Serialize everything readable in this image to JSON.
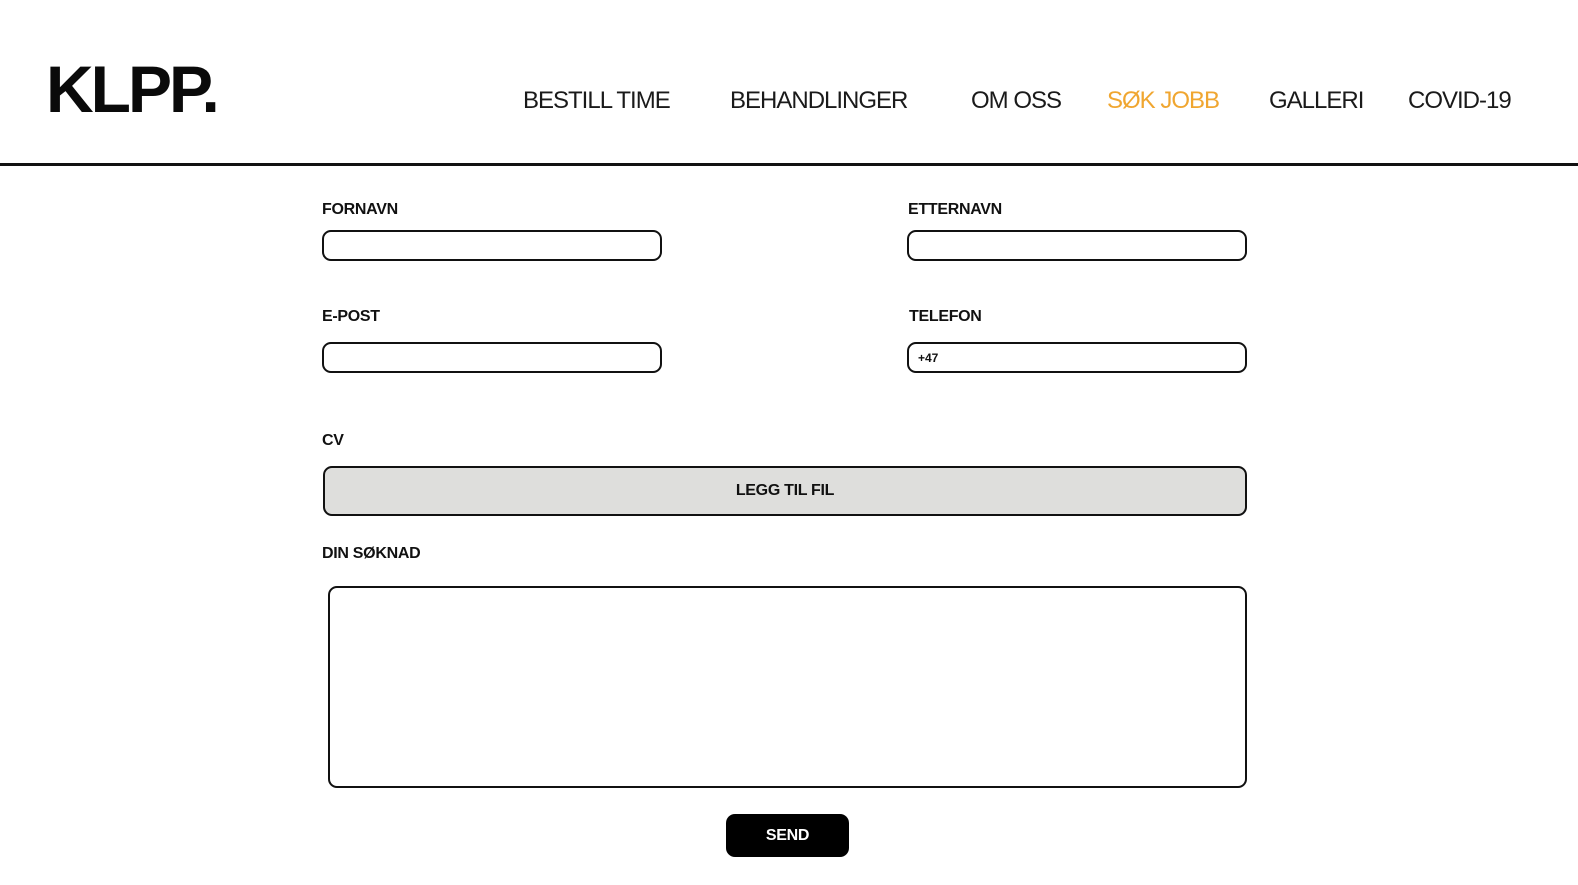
{
  "header": {
    "logo": "KLPP.",
    "nav": [
      {
        "label": "BESTILL TIME",
        "active": false
      },
      {
        "label": "BEHANDLINGER",
        "active": false
      },
      {
        "label": "OM OSS",
        "active": false
      },
      {
        "label": "SØK JOBB",
        "active": true
      },
      {
        "label": "GALLERI",
        "active": false
      },
      {
        "label": "COVID-19",
        "active": false
      }
    ],
    "active_color": "#f0a630"
  },
  "form": {
    "first_name": {
      "label": "FORNAVN",
      "value": ""
    },
    "last_name": {
      "label": "ETTERNAVN",
      "value": ""
    },
    "email": {
      "label": "E-POST",
      "value": ""
    },
    "phone": {
      "label": "TELEFON",
      "value": "+47"
    },
    "cv": {
      "label": "CV",
      "button_label": "LEGG TIL FIL"
    },
    "application": {
      "label": "DIN SØKNAD",
      "value": ""
    },
    "send_label": "SEND"
  }
}
